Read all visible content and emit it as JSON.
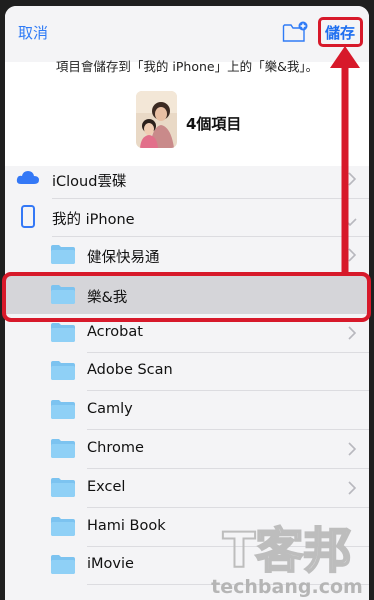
{
  "header": {
    "cancel_label": "取消",
    "save_label": "儲存"
  },
  "notice": "項目會儲存到「我的 iPhone」上的「樂&我」。",
  "items_count": "4個項目",
  "locations": [
    {
      "label": "iCloud雲碟",
      "icon": "cloud-icon"
    },
    {
      "label": "我的 iPhone",
      "icon": "iphone-icon"
    }
  ],
  "folders": [
    {
      "label": "健保快易通",
      "icon": "folder-icon"
    },
    {
      "label": "樂&我",
      "icon": "folder-icon"
    },
    {
      "label": "Acrobat",
      "icon": "folder-icon"
    },
    {
      "label": "Adobe Scan",
      "icon": "folder-icon"
    },
    {
      "label": "Camly",
      "icon": "folder-icon"
    },
    {
      "label": "Chrome",
      "icon": "folder-icon"
    },
    {
      "label": "Excel",
      "icon": "folder-icon"
    },
    {
      "label": "Hami Book",
      "icon": "folder-icon"
    },
    {
      "label": "iMovie",
      "icon": "folder-icon"
    }
  ],
  "watermark": {
    "brand_cn": "T客邦",
    "brand_en": "techbang.com"
  },
  "colors": {
    "accent": "#2f7bf6",
    "annotation": "#d7192a",
    "folder": "#7cc3f0",
    "background": "#f4f4f6"
  }
}
